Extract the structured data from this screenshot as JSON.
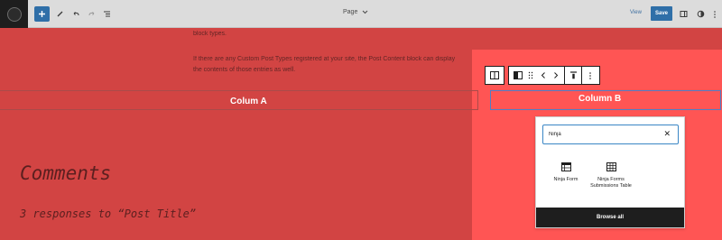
{
  "topbar": {
    "document_title": "Page",
    "view_label": "View",
    "save_label": "Save"
  },
  "content": {
    "paragraph1": "block types.",
    "paragraph2_line1": "If there are any Custom Post Types registered at your site, the Post Content block can display",
    "paragraph2_line2": "the contents of those entries as well.",
    "column_a_label": "Colum A",
    "column_b_label": "Column B",
    "comments_heading": "Comments",
    "responses_text": "3 responses to “Post Title”"
  },
  "inserter": {
    "search_value": "Ninja",
    "results": [
      {
        "label": "Ninja Form",
        "icon": "form-table-icon"
      },
      {
        "label": "Ninja Forms Submissions Table",
        "icon": "grid-table-icon"
      }
    ],
    "browse_all_label": "Browse all"
  },
  "colors": {
    "column_a_bg": "#d24443",
    "column_b_bg": "#ff5554",
    "accent": "#2f6fa8",
    "focus_border": "#3a86c5"
  }
}
